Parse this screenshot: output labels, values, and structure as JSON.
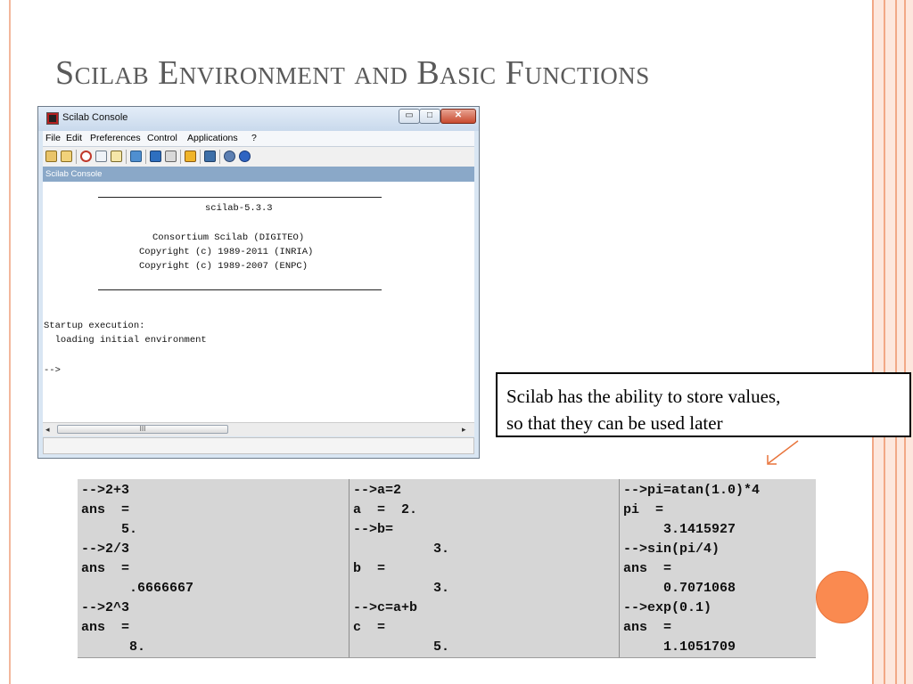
{
  "slide": {
    "title": "Scilab Environment and Basic Functions",
    "callout": "Scilab has the ability to store values,\nso that they can be used later"
  },
  "window": {
    "title": "Scilab Console",
    "controls": {
      "minimize": "▭",
      "maximize": "□",
      "close": "✕"
    },
    "menu": [
      "File",
      "Edit",
      "Preferences",
      "Control",
      "Applications",
      "?"
    ],
    "tab_label": "Scilab Console",
    "console_lines": {
      "version": "scilab-5.3.3",
      "consortium": "Consortium Scilab (DIGITEO)",
      "copyright1": "Copyright (c) 1989-2011 (INRIA)",
      "copyright2": "Copyright (c) 1989-2007 (ENPC)",
      "startup": "Startup execution:",
      "loading": "  loading initial environment",
      "prompt": "-->"
    },
    "scrollbar": {
      "left": "◂",
      "right": "▸",
      "thumb": "III"
    }
  },
  "toolbar_icons": [
    "new-file-icon",
    "open-folder-icon",
    "cut-icon",
    "copy-icon",
    "paste-icon",
    "folder-icon",
    "font-icon",
    "print-icon",
    "tools-icon",
    "console-icon",
    "gear-icon",
    "help-icon"
  ],
  "examples": {
    "col1": [
      "-->2+3",
      "ans  =",
      "     5.",
      "-->2/3",
      "ans  =",
      "      .6666667",
      "-->2^3",
      "ans  =",
      "      8."
    ],
    "col2": [
      "-->a=2",
      "a  =  2.",
      "-->b=",
      "          3.",
      "b  =",
      "          3.",
      "-->c=a+b",
      "c  =",
      "          5."
    ],
    "col3": [
      "-->pi=atan(1.0)*4",
      "pi  =",
      "     3.1415927",
      "-->sin(pi/4)",
      "ans  =",
      "     0.7071068",
      "-->exp(0.1)",
      "ans  =",
      "     1.1051709"
    ]
  },
  "colors": {
    "accent_orange": "#fa8a50",
    "title_gray": "#5a5a5a",
    "tab_blue": "#8aa8c8"
  }
}
